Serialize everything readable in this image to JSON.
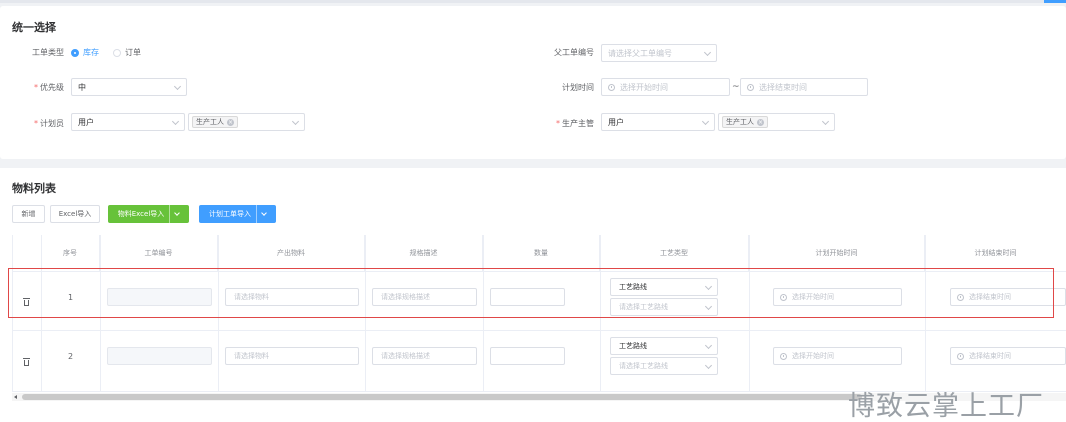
{
  "form": {
    "title": "统一选择",
    "order_type_label": "工单类型",
    "order_type_options": [
      {
        "label": "库存",
        "selected": true
      },
      {
        "label": "订单",
        "selected": false
      }
    ],
    "parent_order_label": "父工单编号",
    "parent_order_placeholder": "请选择父工单编号",
    "priority_label": "优先级",
    "priority_value": "中",
    "plan_time_label": "计划时间",
    "plan_start_placeholder": "选择开始时间",
    "plan_range_sep": "~",
    "plan_end_placeholder": "选择结束时间",
    "planner_label": "计划员",
    "planner_type_value": "用户",
    "planner_tag": "生产工人",
    "supervisor_label": "生产主管",
    "supervisor_type_value": "用户",
    "supervisor_tag": "生产工人"
  },
  "materials": {
    "title": "物料列表",
    "buttons": {
      "add": "新增",
      "excel_import": "Excel导入",
      "material_excel_import": "物料Excel导入",
      "plan_order_import": "计划工单导入"
    },
    "columns": [
      "序号",
      "工单编号",
      "产出物料",
      "规格描述",
      "数量",
      "工艺类型",
      "计划开始时间",
      "计划结束时间"
    ],
    "rows": [
      {
        "index": "1",
        "material_placeholder": "请选择物料",
        "spec_placeholder": "请选择规格描述",
        "process_type_value": "工艺路线",
        "process_route_placeholder": "请选择工艺路线",
        "start_placeholder": "选择开始时间",
        "end_placeholder": "选择结束时间"
      },
      {
        "index": "2",
        "material_placeholder": "请选择物料",
        "spec_placeholder": "请选择规格描述",
        "process_type_value": "工艺路线",
        "process_route_placeholder": "请选择工艺路线",
        "start_placeholder": "选择开始时间",
        "end_placeholder": "选择结束时间"
      }
    ]
  },
  "watermark": "博致云掌上工厂",
  "colors": {
    "primary": "#409eff",
    "success": "#67c23a",
    "required": "#f56c6c",
    "highlight_box": "#e04848"
  }
}
